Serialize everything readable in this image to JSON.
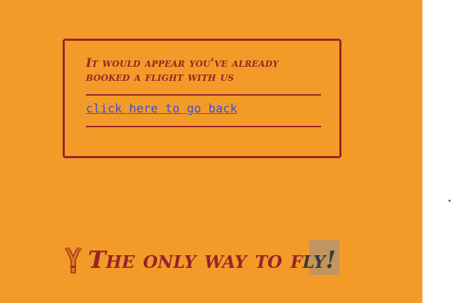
{
  "card": {
    "message": "It would appear you've already booked a flight with us",
    "back_link": "click here to go back"
  },
  "tagline": {
    "text_main": "The only way to f",
    "text_highlighted": "ly!"
  },
  "icons": {
    "tagline_icon": "slingshot-icon"
  },
  "colors": {
    "panel_background": "#f39b29",
    "accent": "#9b2226",
    "link": "#3b4fd0",
    "highlight": "#b8946a"
  }
}
